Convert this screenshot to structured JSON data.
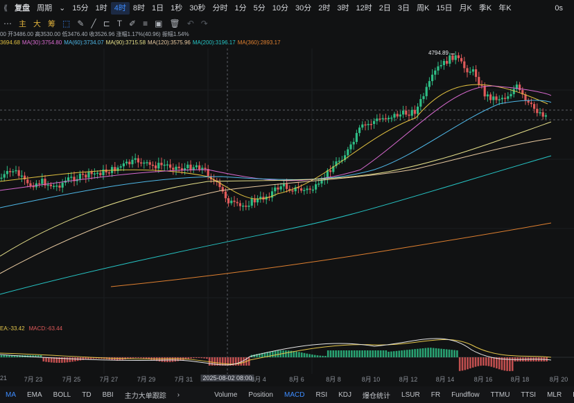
{
  "toolbar": {
    "left_icon": "resize-icon",
    "items": [
      {
        "label": "复盘",
        "name": "replay-button"
      },
      {
        "label": "周期",
        "name": "period-dropdown"
      },
      {
        "label": "15分"
      },
      {
        "label": "1时"
      },
      {
        "label": "4时",
        "active": true
      },
      {
        "label": "8时"
      },
      {
        "label": "1日"
      },
      {
        "label": "1秒"
      },
      {
        "label": "30秒"
      },
      {
        "label": "分时"
      },
      {
        "label": "1分"
      },
      {
        "label": "5分"
      },
      {
        "label": "10分"
      },
      {
        "label": "30分"
      },
      {
        "label": "2时"
      },
      {
        "label": "3时"
      },
      {
        "label": "12时"
      },
      {
        "label": "2日"
      },
      {
        "label": "3日"
      },
      {
        "label": "周K"
      },
      {
        "label": "15日"
      },
      {
        "label": "月K"
      },
      {
        "label": "季K"
      },
      {
        "label": "年K"
      }
    ],
    "right_label": "0s"
  },
  "drawbar": {
    "buttons": [
      "主",
      "大",
      "筹"
    ],
    "icons": [
      "more-icon",
      "select-icon",
      "pencil-icon",
      "line-tool-icon",
      "ruler-icon",
      "text-icon",
      "brush-icon",
      "fib-icon",
      "image-icon",
      "trash-icon",
      "undo-icon",
      "redo-icon"
    ]
  },
  "ohlc": "00  开3486.00  高3530.00  低3476.40  收3526.96  涨幅1.17%(40.96)  振幅1.54%",
  "ma_legend": [
    {
      "text": "3694.68",
      "color": "#e0c040"
    },
    {
      "text": "MA(30):3754.80",
      "color": "#d96ad0"
    },
    {
      "text": "MA(60):3734.07",
      "color": "#4fb8e8"
    },
    {
      "text": "MA(90):3715.58",
      "color": "#e6e08a"
    },
    {
      "text": "MA(120):3575.96",
      "color": "#e8c9a0"
    },
    {
      "text": "MA(200):3196.17",
      "color": "#26c6c6"
    },
    {
      "text": "MA(360):2893.17",
      "color": "#e08030"
    }
  ],
  "price_callout": "4794.89",
  "macd_legend": [
    {
      "text": "EA:-33.42",
      "color": "#e6c84c"
    },
    {
      "text": "MACD:-63.44",
      "color": "#e05a5a"
    }
  ],
  "date_axis": [
    {
      "label": "21"
    },
    {
      "label": "7月 23"
    },
    {
      "label": "7月 25"
    },
    {
      "label": "7月 27"
    },
    {
      "label": "7月 29"
    },
    {
      "label": "7月 31"
    },
    {
      "label": "2025-08-02 08:00",
      "highlight": true
    },
    {
      "label": "8月 4"
    },
    {
      "label": "8月 6"
    },
    {
      "label": "8月 8"
    },
    {
      "label": "8月 10"
    },
    {
      "label": "8月 12"
    },
    {
      "label": "8月 14"
    },
    {
      "label": "8月 16"
    },
    {
      "label": "8月 18"
    },
    {
      "label": "8月 20"
    }
  ],
  "indicator_bar": {
    "main": [
      {
        "label": "MA",
        "active": true
      },
      {
        "label": "EMA"
      },
      {
        "label": "BOLL"
      },
      {
        "label": "TD"
      },
      {
        "label": "BBI"
      },
      {
        "label": "主力大单跟踪"
      }
    ],
    "more_icon": "chevron-right-icon",
    "sub": [
      {
        "label": "Volume"
      },
      {
        "label": "Position"
      },
      {
        "label": "MACD",
        "active": true
      },
      {
        "label": "RSI"
      },
      {
        "label": "KDJ"
      },
      {
        "label": "爆仓统计"
      },
      {
        "label": "LSUR"
      },
      {
        "label": "FR"
      },
      {
        "label": "Fundflow"
      },
      {
        "label": "TTMU"
      },
      {
        "label": "TTSI"
      },
      {
        "label": "MLR"
      },
      {
        "label": "BSV"
      }
    ]
  },
  "colors": {
    "up": "#2ebd85",
    "down": "#e05a5a",
    "accent": "#3d8cff"
  }
}
